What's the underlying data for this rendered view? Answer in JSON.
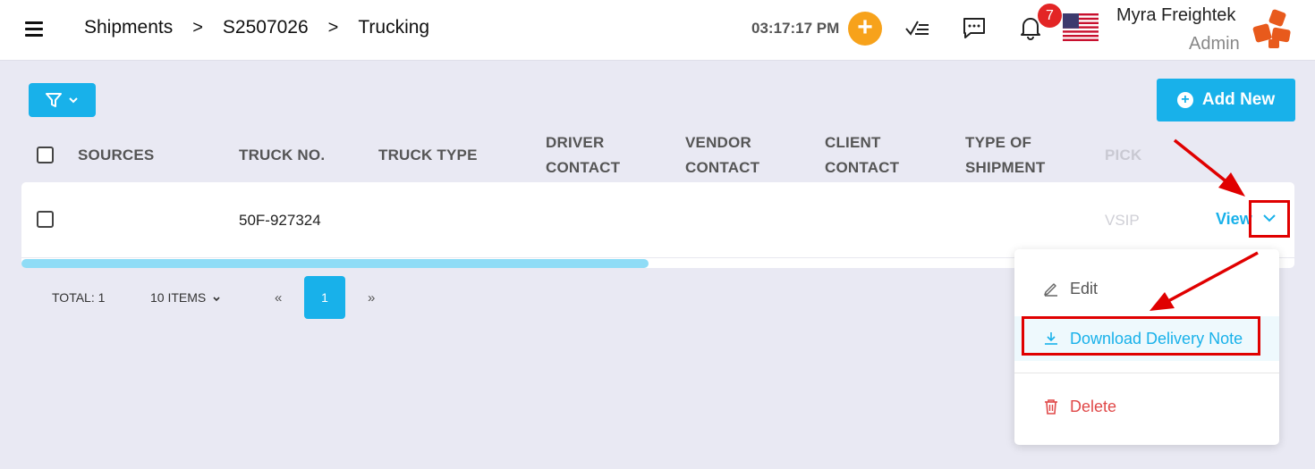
{
  "header": {
    "breadcrumb": [
      "Shipments",
      ">",
      "S2507026",
      ">",
      "Trucking"
    ],
    "clock": "03:17:17 PM",
    "notification_count": "7",
    "user_name": "Myra Freightek",
    "user_role": "Admin"
  },
  "toolbar": {
    "add_new_label": "Add New"
  },
  "table": {
    "columns": [
      {
        "line1": "SOURCES",
        "line2": ""
      },
      {
        "line1": "TRUCK NO.",
        "line2": ""
      },
      {
        "line1": "TRUCK TYPE",
        "line2": ""
      },
      {
        "line1": "DRIVER",
        "line2": "CONTACT"
      },
      {
        "line1": "VENDOR",
        "line2": "CONTACT"
      },
      {
        "line1": "CLIENT",
        "line2": "CONTACT"
      },
      {
        "line1": "TYPE OF",
        "line2": "SHIPMENT"
      },
      {
        "line1": "PICK",
        "line2": ""
      }
    ],
    "row": {
      "truck_no": "50F-927324",
      "pickup": "VSIP",
      "view_label": "View"
    }
  },
  "pagination": {
    "total": "TOTAL: 1",
    "page_size": "10 ITEMS",
    "prev": "«",
    "current": "1",
    "next": "»"
  },
  "dropdown": {
    "edit": "Edit",
    "download": "Download Delivery Note",
    "delete": "Delete"
  },
  "colors": {
    "accent": "#18b1ea",
    "annotation": "#e00000",
    "danger": "#e04848",
    "orange": "#f7a21b"
  }
}
